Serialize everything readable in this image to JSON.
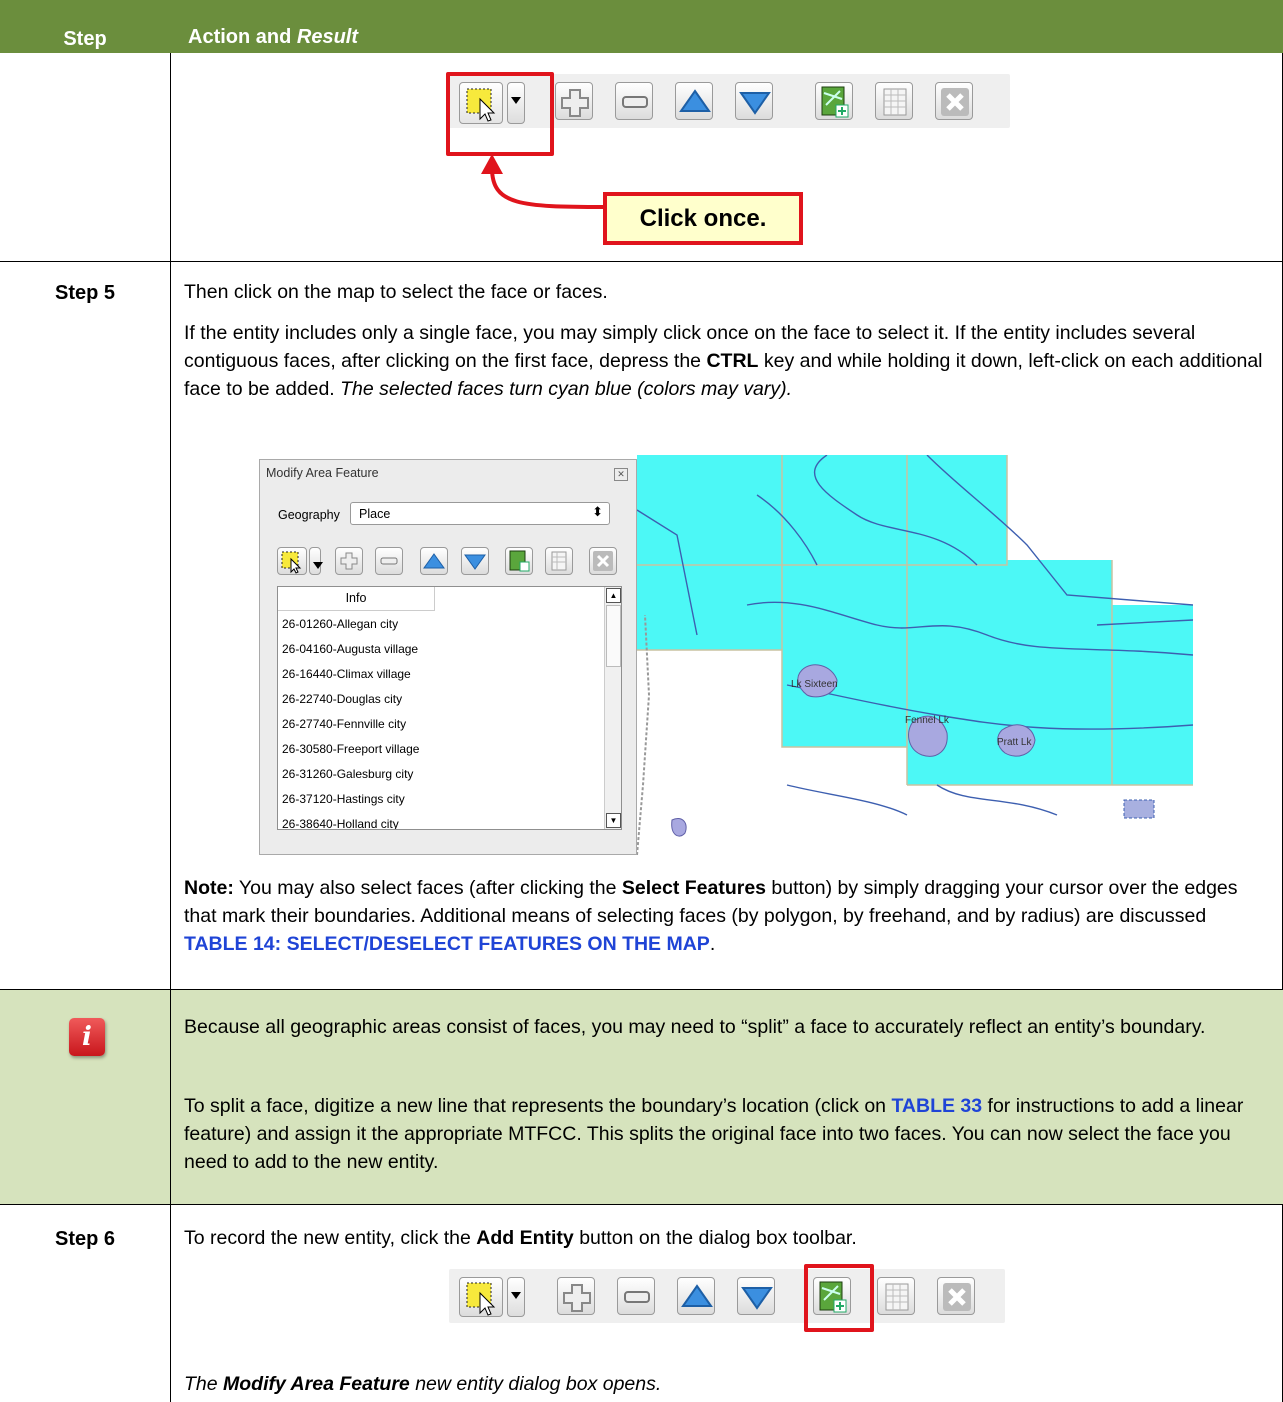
{
  "header": {
    "step_col": "Step",
    "action_col_a": "Action and ",
    "action_col_b": "Result"
  },
  "toolbar_tooltip": "Click once.",
  "step5": {
    "label": "Step 5",
    "p1": "Then click on the map to select the face or faces.",
    "p2_a": "If the entity includes only a single face, you may simply click once on the face to select it. If the entity includes several contiguous faces, after clicking on the first face, depress the ",
    "p2_b": "CTRL",
    "p2_c": " key and while holding it down, left-click on each additional face to be added. ",
    "p2_d": "The selected faces turn cyan blue (colors may vary).",
    "note_a": "Note:",
    "note_b": "  You may also select faces (after clicking the ",
    "note_c": "Select Features",
    "note_d": " button) by simply dragging your cursor over the edges that mark their boundaries. Additional means of selecting faces (by polygon, by freehand, and by radius) are discussed ",
    "note_link": "TABLE 14: SELECT/DESELECT FEATURES ON THE MAP",
    "note_end": "."
  },
  "dialog": {
    "title": "Modify Area Feature",
    "geo_label": "Geography",
    "geo_value": "Place",
    "col_header": "Info",
    "items": [
      "26-01260-Allegan city",
      "26-04160-Augusta village",
      "26-16440-Climax village",
      "26-22740-Douglas city",
      "26-27740-Fennville city",
      "26-30580-Freeport village",
      "26-31260-Galesburg city",
      "26-37120-Hastings city",
      "26-38640-Holland city"
    ]
  },
  "map_labels": {
    "l1": "Lk Sixteen",
    "l2": "Fennel Lk",
    "l3": "Pratt Lk"
  },
  "info_row": {
    "p1": "Because all geographic areas consist of faces, you may need to “split” a face to accurately reflect an entity’s boundary.",
    "p2_a": "To split a face, digitize a new line that represents the boundary’s location (click on ",
    "p2_link": "TABLE 33",
    "p2_b": " for instructions to add a linear feature) and assign it the appropriate MTFCC. This splits the original face into two faces. You can now select the face you need to add to the new entity."
  },
  "step6": {
    "label": "Step 6",
    "p1_a": "To record the new entity, click the ",
    "p1_b": "Add Entity",
    "p1_c": " button on the dialog box toolbar.",
    "p2_a": "The ",
    "p2_b": "Modify Area Feature",
    "p2_c": " new entity dialog box opens."
  },
  "colors": {
    "header": "#6b8e3d",
    "note_row": "#d6e3bd",
    "link": "#1f44d6",
    "highlight": "#e0141c",
    "cyan": "#4cf8f6"
  }
}
